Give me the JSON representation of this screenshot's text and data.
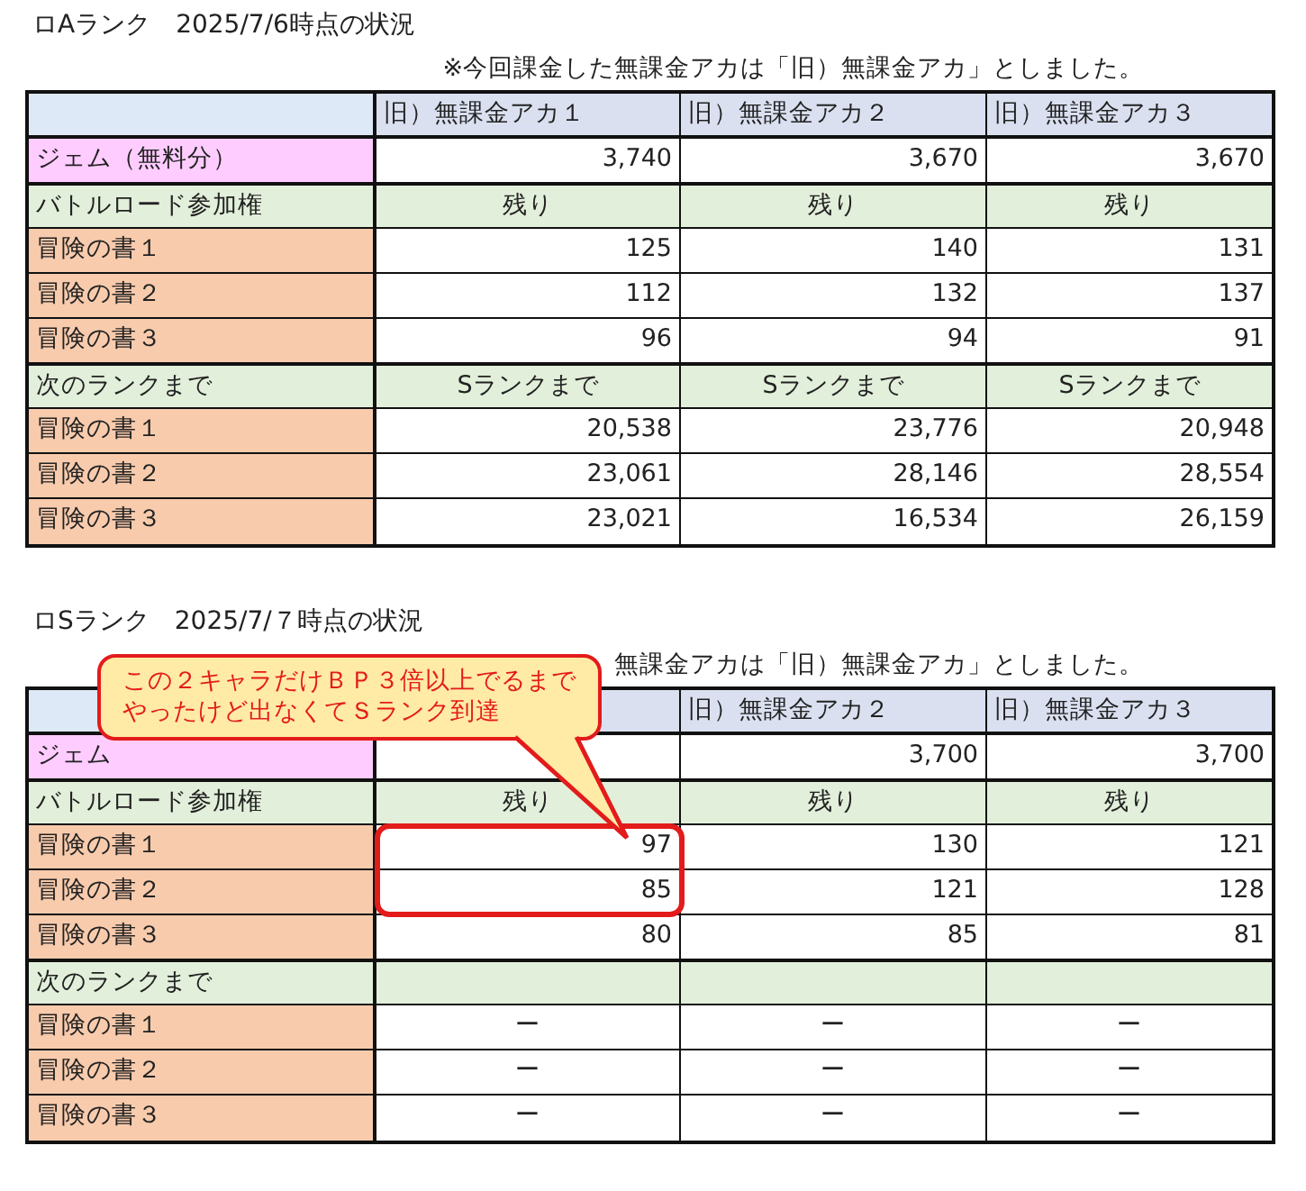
{
  "sections": [
    {
      "title": "ロAランク　2025/7/6時点の状況",
      "note": "※今回課金した無課金アカは「旧）無課金アカ」としました。",
      "rows": [
        {
          "kind": "header",
          "label": null,
          "cells": [
            "旧）無課金アカ１",
            "旧）無課金アカ２",
            "旧）無課金アカ３"
          ]
        },
        {
          "kind": "gem",
          "label": "ジェム（無料分）",
          "cells": [
            "3,740",
            "3,670",
            "3,670"
          ]
        },
        {
          "kind": "group",
          "label": "バトルロード参加権",
          "cells": [
            "残り",
            "残り",
            "残り"
          ]
        },
        {
          "kind": "number",
          "label": "冒険の書１",
          "cells": [
            "125",
            "140",
            "131"
          ]
        },
        {
          "kind": "number",
          "label": "冒険の書２",
          "cells": [
            "112",
            "132",
            "137"
          ]
        },
        {
          "kind": "number",
          "label": "冒険の書３",
          "cells": [
            "96",
            "94",
            "91"
          ]
        },
        {
          "kind": "group",
          "label": "次のランクまで",
          "cells": [
            "Sランクまで",
            "Sランクまで",
            "Sランクまで"
          ]
        },
        {
          "kind": "number",
          "label": "冒険の書１",
          "cells": [
            "20,538",
            "23,776",
            "20,948"
          ]
        },
        {
          "kind": "number",
          "label": "冒険の書２",
          "cells": [
            "23,061",
            "28,146",
            "28,554"
          ]
        },
        {
          "kind": "number",
          "label": "冒険の書３",
          "cells": [
            "23,021",
            "16,534",
            "26,159"
          ]
        }
      ]
    },
    {
      "title": "ロSランク　2025/7/７時点の状況",
      "note": "無課金アカは「旧）無課金アカ」としました。",
      "callout": "この２キャラだけＢＰ３倍以上でるまでやったけど出なくてＳランク到達",
      "rows": [
        {
          "kind": "header",
          "label": null,
          "cells": [
            null,
            "旧）無課金アカ２",
            "旧）無課金アカ３"
          ]
        },
        {
          "kind": "gem",
          "label": "ジェム",
          "cells": [
            null,
            "3,700",
            "3,700"
          ]
        },
        {
          "kind": "group",
          "label": "バトルロード参加権",
          "cells": [
            "残り",
            "残り",
            "残り"
          ]
        },
        {
          "kind": "number",
          "label": "冒険の書１",
          "circled": true,
          "cells": [
            "97",
            "130",
            "121"
          ]
        },
        {
          "kind": "number",
          "label": "冒険の書２",
          "circled": true,
          "cells": [
            "85",
            "121",
            "128"
          ]
        },
        {
          "kind": "number",
          "label": "冒険の書３",
          "circled": false,
          "cells": [
            "80",
            "85",
            "81"
          ]
        },
        {
          "kind": "group",
          "label": "次のランクまで",
          "cells": [
            null,
            null,
            null
          ]
        },
        {
          "kind": "dash",
          "label": "冒険の書１",
          "cells": [
            "ー",
            "ー",
            "ー"
          ]
        },
        {
          "kind": "dash",
          "label": "冒険の書２",
          "cells": [
            "ー",
            "ー",
            "ー"
          ]
        },
        {
          "kind": "dash",
          "label": "冒険の書３",
          "cells": [
            "ー",
            "ー",
            "ー"
          ]
        }
      ]
    }
  ]
}
